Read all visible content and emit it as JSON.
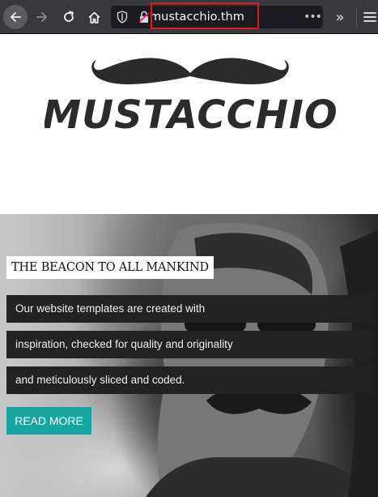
{
  "browser": {
    "url": "mustacchio.thm",
    "page_actions_label": "•••",
    "overflow_label": "»",
    "icons": [
      "back-arrow-icon",
      "forward-arrow-icon",
      "reload-icon",
      "home-icon",
      "shield-icon",
      "lock-icon",
      "more-actions-icon",
      "overflow-chevron-icon",
      "hamburger-menu-icon"
    ]
  },
  "site": {
    "logo_text": "MUSTACCHIO"
  },
  "hero": {
    "title": "THE BEACON TO ALL MANKIND",
    "lines": [
      "Our website templates are created with",
      "inspiration, checked for quality and originality",
      "and meticulously sliced and coded."
    ],
    "cta_label": "READ MORE"
  },
  "colors": {
    "toolbar_bg": "#38383d",
    "urlbar_bg": "#1c1b22",
    "url_highlight": "#e01b1b",
    "caption_bg": "#222222",
    "cta_bg": "#16a5a0"
  }
}
